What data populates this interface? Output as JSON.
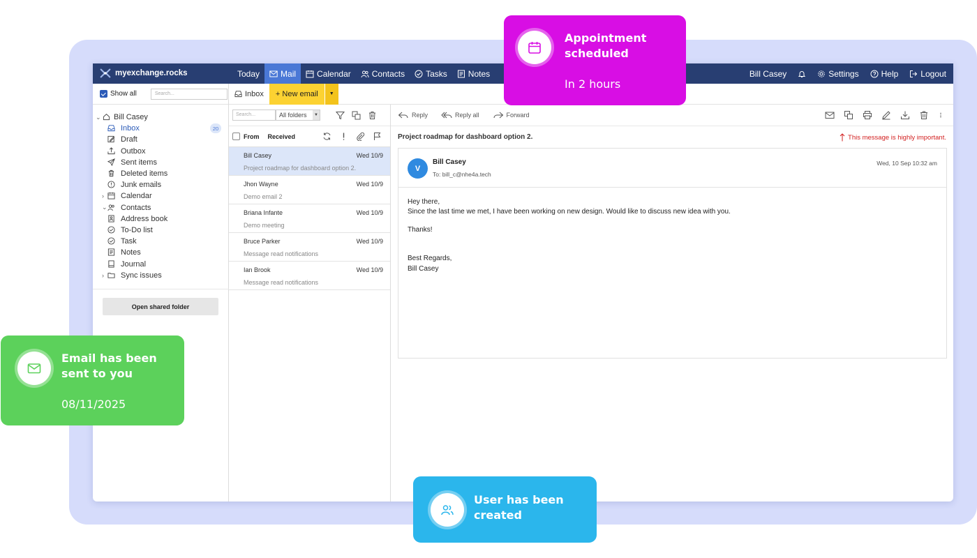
{
  "topbar": {
    "logo_text": "myexchange.rocks",
    "nav": [
      {
        "label": "Today",
        "icon": ""
      },
      {
        "label": "Mail",
        "icon": "mail-icon",
        "active": true
      },
      {
        "label": "Calendar",
        "icon": "calendar-icon"
      },
      {
        "label": "Contacts",
        "icon": "contacts-icon"
      },
      {
        "label": "Tasks",
        "icon": "tasks-icon"
      },
      {
        "label": "Notes",
        "icon": "notes-icon"
      }
    ],
    "user_name": "Bill Casey",
    "settings_label": "Settings",
    "help_label": "Help",
    "logout_label": "Logout"
  },
  "sidebar": {
    "show_all_label": "Show all",
    "search_placeholder": "Search...",
    "root_label": "Bill Casey",
    "items": [
      {
        "label": "Inbox",
        "icon": "inbox-icon",
        "badge": "20"
      },
      {
        "label": "Draft",
        "icon": "draft-icon"
      },
      {
        "label": "Outbox",
        "icon": "outbox-icon"
      },
      {
        "label": "Sent items",
        "icon": "send-icon"
      },
      {
        "label": "Deleted items",
        "icon": "trash-icon"
      },
      {
        "label": "Junk emails",
        "icon": "junk-icon"
      },
      {
        "label": "Calendar",
        "icon": "calendar-icon"
      },
      {
        "label": "Contacts",
        "icon": "contacts-icon"
      },
      {
        "label": "Address book",
        "icon": "address-book-icon"
      },
      {
        "label": "To-Do list",
        "icon": "todo-icon"
      },
      {
        "label": "Task",
        "icon": "task-icon"
      },
      {
        "label": "Notes",
        "icon": "notes-icon"
      },
      {
        "label": "Journal",
        "icon": "journal-icon"
      },
      {
        "label": "Sync issues",
        "icon": "folder-icon"
      }
    ],
    "open_shared_label": "Open shared folder"
  },
  "actionbar": {
    "inbox_label": "Inbox",
    "new_email_label": "+ New email"
  },
  "message_list": {
    "search_placeholder": "Search...",
    "folder_select": "All folders",
    "col_from": "From",
    "col_received": "Received",
    "rows": [
      {
        "from": "Bill Casey",
        "date": "Wed 10/9",
        "subject": "Project roadmap for dashboard option 2."
      },
      {
        "from": "Jhon Wayne",
        "date": "Wed 10/9",
        "subject": "Demo email 2"
      },
      {
        "from": "Briana Infante",
        "date": "Wed 10/9",
        "subject": "Demo meeting"
      },
      {
        "from": "Bruce Parker",
        "date": "Wed 10/9",
        "subject": "Message read notifications"
      },
      {
        "from": "Ian Brook",
        "date": "Wed 10/9",
        "subject": "Message read notifications"
      }
    ]
  },
  "reader": {
    "reply_label": "Reply",
    "reply_all_label": "Reply all",
    "forward_label": "Forward",
    "subject": "Project roadmap for dashboard option 2.",
    "importance_text": "This message is highly important.",
    "avatar_letter": "V",
    "sender": "Bill Casey",
    "to": "To: bill_c@nhe4a.tech",
    "date": "Wed, 10 Sep 10:32 am",
    "body": {
      "line1": "Hey there,",
      "line2": "Since the last time we met, I have been working on new design. Would like to discuss new idea with you.",
      "line3": "Thanks!",
      "line4": "Best Regards,",
      "line5": "Bill Casey"
    }
  },
  "toasts": {
    "appointment": {
      "title": "Appointment scheduled",
      "subtitle": "In 2 hours",
      "color": "#d80ee4"
    },
    "email": {
      "title": "Email has been sent to you",
      "subtitle": "08/11/2025",
      "color": "#5cd15b"
    },
    "user": {
      "title": "User has been created",
      "color": "#2bb6ec"
    }
  },
  "colors": {
    "topbar": "#283e72",
    "active_nav": "#4a78d6",
    "new_email": "#fcd232",
    "background_panel": "#d6dcfb",
    "important": "#d21f1f"
  }
}
